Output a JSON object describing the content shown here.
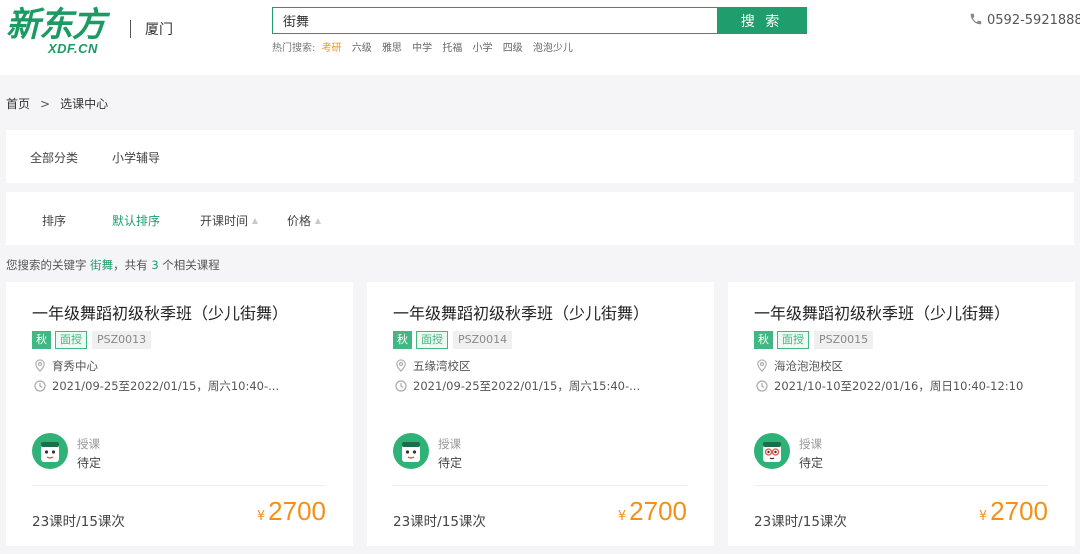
{
  "header": {
    "logo_main": "新东方",
    "logo_sub": "XDF.CN",
    "city": "厦门",
    "search_value": "街舞",
    "search_button": "搜 索",
    "hot_label": "热门搜索:",
    "hot_items": [
      "考研",
      "六级",
      "雅思",
      "中学",
      "托福",
      "小学",
      "四级",
      "泡泡少儿"
    ],
    "phone": "0592-5921888"
  },
  "breadcrumb": {
    "home": "首页",
    "separator": ">",
    "current": "选课中心"
  },
  "category_filter": {
    "all_label": "全部分类",
    "selected": "小学辅导"
  },
  "sort_bar": {
    "label": "排序",
    "options": [
      "默认排序",
      "开课时间",
      "价格"
    ],
    "active_color": "#1f9d6c"
  },
  "results": {
    "prefix": "您搜索的关键字",
    "keyword": "街舞",
    "middle": "，共有",
    "count": "3",
    "suffix": "个相关课程"
  },
  "colors": {
    "brand": "#1b9b63",
    "accent_green": "#41b883",
    "price_orange": "#f29117"
  },
  "courses": [
    {
      "title": "一年级舞蹈初级秋季班（少儿街舞）",
      "season_tag": "秋",
      "mode_tag": "面授",
      "code": "PSZ0013",
      "location": "育秀中心",
      "time": "2021/09-25至2022/01/15，周六10:40-...",
      "teacher_label": "授课",
      "teacher": "待定",
      "lessons": "23课时/15课次",
      "currency": "¥",
      "price": "2700",
      "avatar_icon": "teacher-avatar-icon"
    },
    {
      "title": "一年级舞蹈初级秋季班（少儿街舞）",
      "season_tag": "秋",
      "mode_tag": "面授",
      "code": "PSZ0014",
      "location": "五缘湾校区",
      "time": "2021/09-25至2022/01/15，周六15:40-...",
      "teacher_label": "授课",
      "teacher": "待定",
      "lessons": "23课时/15课次",
      "currency": "¥",
      "price": "2700",
      "avatar_icon": "teacher-avatar-icon"
    },
    {
      "title": "一年级舞蹈初级秋季班（少儿街舞）",
      "season_tag": "秋",
      "mode_tag": "面授",
      "code": "PSZ0015",
      "location": "海沧泡泡校区",
      "time": "2021/10-10至2022/01/16，周日10:40-12:10",
      "teacher_label": "授课",
      "teacher": "待定",
      "lessons": "23课时/15课次",
      "currency": "¥",
      "price": "2700",
      "avatar_icon": "teacher-avatar-glasses-icon"
    }
  ]
}
